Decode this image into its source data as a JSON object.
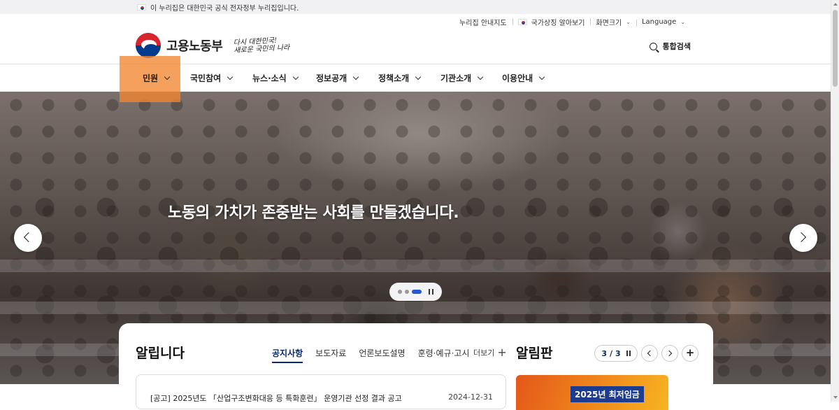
{
  "gov_strip": {
    "text": "이 누리집은 대한민국 공식 전자정부 누리집입니다."
  },
  "utility": {
    "sitemap": "누리집 안내지도",
    "national_symbols": "국가상징 알아보기",
    "screen_size": "화면크기",
    "language": "Language"
  },
  "logo": {
    "name": "고용노동부",
    "slogan_line1": "다시 대한민국!",
    "slogan_line2": "새로운 국민의 나라"
  },
  "search": {
    "label": "통합검색"
  },
  "gnb": {
    "items": [
      {
        "label": "민원"
      },
      {
        "label": "국민참여"
      },
      {
        "label": "뉴스·소식"
      },
      {
        "label": "정보공개"
      },
      {
        "label": "정책소개"
      },
      {
        "label": "기관소개"
      },
      {
        "label": "이용안내"
      }
    ],
    "active_index": 0
  },
  "hero": {
    "title": "노동의 가치가 존중받는 사회를 만들겠습니다.",
    "slide_count": 3,
    "active_slide": 3
  },
  "notice": {
    "title": "알립니다",
    "tabs": [
      "공지사항",
      "보도자료",
      "언론보도설명",
      "훈령·예규·고시"
    ],
    "active_tab": 0,
    "more_label": "더보기",
    "rows": [
      {
        "title": "[공고] 2025년도 「산업구조변화대응 등 특화훈련」 운영기관 선정 결과 공고",
        "date": "2024-12-31"
      }
    ]
  },
  "board": {
    "title": "알림판",
    "current": "3",
    "separator": "/",
    "total": "3",
    "banner_text": "2025년 최저임금"
  },
  "colors": {
    "accent_navy": "#0a2a6b",
    "highlight_orange": "#f28730",
    "pager_active": "#2457d6"
  }
}
